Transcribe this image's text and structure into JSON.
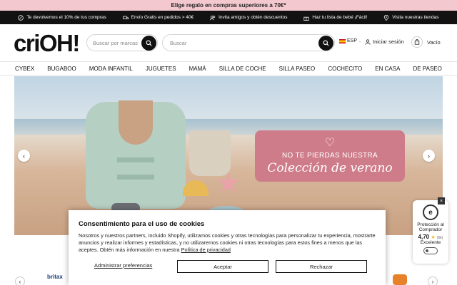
{
  "promo_bar": {
    "text": "Elige regalo en compras superiores a 70€*"
  },
  "info_bar": [
    {
      "icon": "percent-icon",
      "text": "Te devolvemos el 10% de tus compras"
    },
    {
      "icon": "truck-icon",
      "text": "Envío Gratis en pedidos > 40€"
    },
    {
      "icon": "users-icon",
      "text": "Invita amigos y obtén descuentos"
    },
    {
      "icon": "gift-icon",
      "text": "Haz tu lista de bebé ¡Fácil!"
    },
    {
      "icon": "pin-icon",
      "text": "Visita nuestras tiendas"
    }
  ],
  "header": {
    "logo": "criOH!",
    "brand_search_placeholder": "Buscar por marcas",
    "search_placeholder": "Buscar",
    "language": "ESP",
    "login_label": "Iniciar sesión",
    "cart_label": "Vacío"
  },
  "nav": [
    "CYBEX",
    "BUGABOO",
    "MODA INFANTIL",
    "JUGUETES",
    "MAMÁ",
    "SILLA DE COCHE",
    "SILLA PASEO",
    "COCHECITO",
    "EN CASA",
    "DE PASEO"
  ],
  "hero": {
    "line1": "NO TE PIERDAS NUESTRA",
    "line2": "Colección de verano"
  },
  "brands": {
    "first": "britax"
  },
  "cookie": {
    "title": "Consentimiento para el uso de cookies",
    "body": "Nosotros y nuestros partners, incluido Shopify, utilizamos cookies y otras tecnologías para personalizar tu experiencia, mostrarte anuncios y realizar informes y estadísticas, y no utilizaremos cookies ni otras tecnologías para estos fines a menos que las aceptes. Obtén más información en nuestra",
    "policy_link": "Política de privacidad",
    "manage_label": "Administrar preferencias",
    "accept_label": "Aceptar",
    "reject_label": "Rechazar"
  },
  "trust_badge": {
    "seal": "e",
    "line1": "Protección al Comprador",
    "rating": "4,70",
    "count": "(5k)",
    "label": "Excelente"
  },
  "colors": {
    "promo_bg": "#f3c9cf",
    "info_bg": "#121212",
    "card_pink": "#cf7c8a"
  }
}
